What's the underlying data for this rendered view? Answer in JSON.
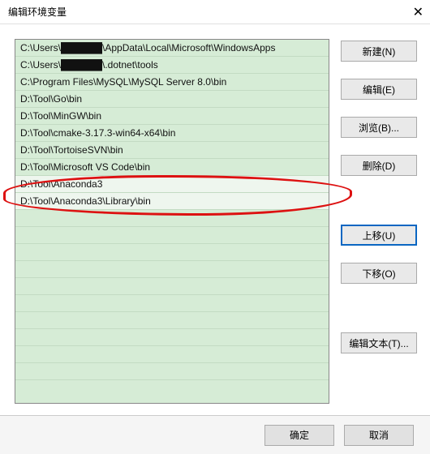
{
  "window": {
    "title": "编辑环境变量",
    "close": "✕"
  },
  "paths": [
    "C:\\Users\\██████\\AppData\\Local\\Microsoft\\WindowsApps",
    "C:\\Users\\██████\\.dotnet\\tools",
    "C:\\Program Files\\MySQL\\MySQL Server 8.0\\bin",
    "D:\\Tool\\Go\\bin",
    "D:\\Tool\\MinGW\\bin",
    "D:\\Tool\\cmake-3.17.3-win64-x64\\bin",
    "D:\\Tool\\TortoiseSVN\\bin",
    "D:\\Tool\\Microsoft VS Code\\bin",
    "D:\\Tool\\Anaconda3",
    "D:\\Tool\\Anaconda3\\Library\\bin"
  ],
  "selected_indices": [
    8,
    9
  ],
  "buttons": {
    "new": "新建(N)",
    "edit": "编辑(E)",
    "browse": "浏览(B)...",
    "delete": "删除(D)",
    "move_up": "上移(U)",
    "move_down": "下移(O)",
    "edit_text": "编辑文本(T)..."
  },
  "footer": {
    "ok": "确定",
    "cancel": "取消"
  }
}
